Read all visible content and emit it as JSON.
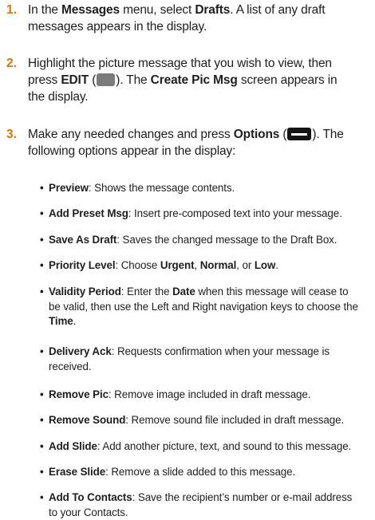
{
  "steps": [
    {
      "number": "1.",
      "lines": [
        [
          {
            "t": "In the "
          },
          {
            "t": "Messages",
            "b": true
          },
          {
            "t": " menu, select "
          },
          {
            "t": "Drafts",
            "b": true
          },
          {
            "t": ". A list of any draft"
          }
        ],
        [
          {
            "t": "messages appears in the display."
          }
        ]
      ]
    },
    {
      "number": "2.",
      "lines": [
        [
          {
            "t": "Highlight the picture message that you wish to view, then"
          }
        ],
        [
          {
            "t": "press "
          },
          {
            "t": "EDIT",
            "b": true
          },
          {
            "t": " ("
          },
          {
            "key": "gray"
          },
          {
            "t": "). The "
          },
          {
            "t": "Create Pic Msg",
            "b": true
          },
          {
            "t": " screen appears in"
          }
        ],
        [
          {
            "t": "the display."
          }
        ]
      ]
    },
    {
      "number": "3.",
      "lines": [
        [
          {
            "t": "Make any needed changes and press "
          },
          {
            "t": "Options",
            "b": true
          },
          {
            "t": " ("
          },
          {
            "key": "black"
          },
          {
            "t": "). The"
          }
        ],
        [
          {
            "t": "following options appear in the display:"
          }
        ]
      ]
    }
  ],
  "options": [
    {
      "lines": [
        [
          {
            "t": "Preview",
            "b": true
          },
          {
            "t": ": Shows the message contents."
          }
        ]
      ]
    },
    {
      "lines": [
        [
          {
            "t": "Add Preset Msg",
            "b": true
          },
          {
            "t": ": Insert pre-composed text into your message."
          }
        ]
      ]
    },
    {
      "lines": [
        [
          {
            "t": "Save As Draft",
            "b": true
          },
          {
            "t": ": Saves the changed message to the Draft Box."
          }
        ]
      ]
    },
    {
      "lines": [
        [
          {
            "t": "Priority Level",
            "b": true
          },
          {
            "t": ": Choose "
          },
          {
            "t": "Urgent",
            "b": true
          },
          {
            "t": ", "
          },
          {
            "t": "Normal",
            "b": true
          },
          {
            "t": ", or "
          },
          {
            "t": "Low",
            "b": true
          },
          {
            "t": "."
          }
        ]
      ]
    },
    {
      "lines": [
        [
          {
            "t": "Validity Period",
            "b": true
          },
          {
            "t": ": Enter the "
          },
          {
            "t": "Date",
            "b": true
          },
          {
            "t": " when this message will cease to"
          }
        ],
        [
          {
            "t": "be valid, then use the Left and Right navigation keys to choose the"
          }
        ],
        [
          {
            "t": "Time",
            "b": true
          },
          {
            "t": "."
          }
        ]
      ]
    },
    {
      "lines": [
        [
          {
            "t": "Delivery Ack",
            "b": true
          },
          {
            "t": ": Requests confirmation when your message is"
          }
        ],
        [
          {
            "t": "received."
          }
        ]
      ]
    },
    {
      "lines": [
        [
          {
            "t": "Remove Pic",
            "b": true
          },
          {
            "t": ": Remove image included in draft message."
          }
        ]
      ]
    },
    {
      "lines": [
        [
          {
            "t": "Remove Sound",
            "b": true
          },
          {
            "t": ": Remove sound file included in draft message."
          }
        ]
      ]
    },
    {
      "lines": [
        [
          {
            "t": "Add Slide",
            "b": true
          },
          {
            "t": ": Add another picture, text, and sound to this message."
          }
        ]
      ]
    },
    {
      "lines": [
        [
          {
            "t": "Erase Slide",
            "b": true
          },
          {
            "t": ": Remove a slide added to this message."
          }
        ]
      ]
    },
    {
      "lines": [
        [
          {
            "t": "Add To Contacts",
            "b": true
          },
          {
            "t": ": Save the recipient’s number or e-mail address"
          }
        ],
        [
          {
            "t": "to your Contacts."
          }
        ]
      ]
    }
  ],
  "bullet_char": "•",
  "colors": {
    "step_number": "#d4760a",
    "text": "#1e1e1e",
    "edit_key": "#7b7b7b",
    "options_key": "#141414"
  }
}
